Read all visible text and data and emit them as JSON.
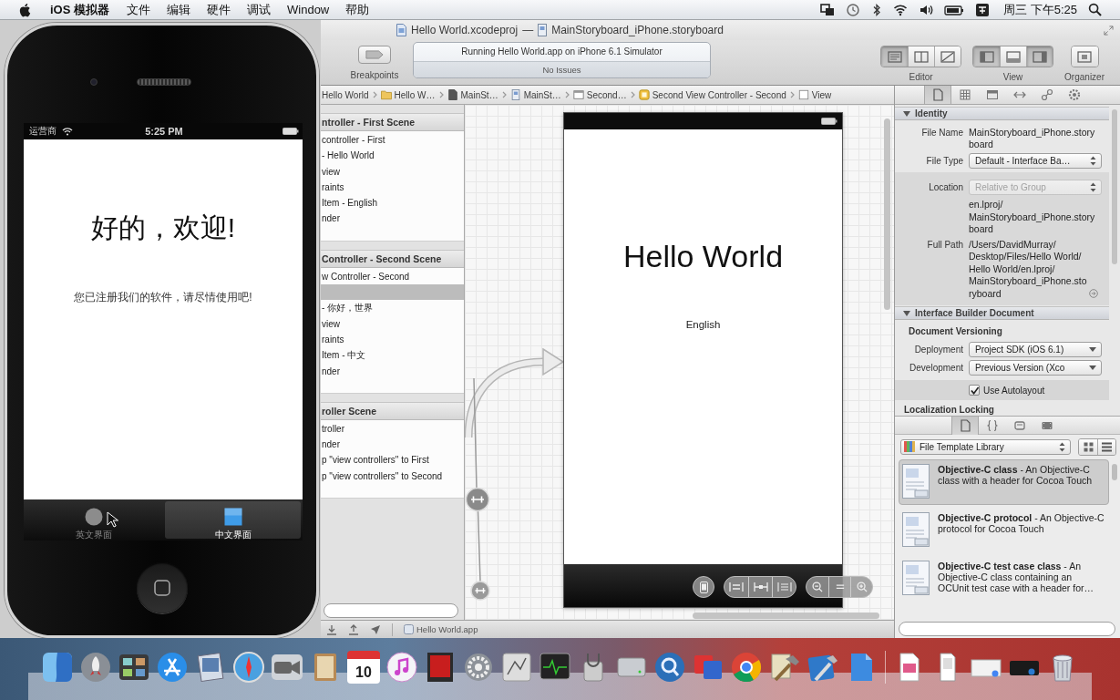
{
  "menu_bar": {
    "app_name": "iOS 模拟器",
    "menus": [
      "文件",
      "编辑",
      "硬件",
      "调试",
      "Window",
      "帮助"
    ],
    "clock": "周三 下午5:25"
  },
  "xcode": {
    "title": {
      "project": "Hello World.xcodeproj",
      "separator": "—",
      "file": "MainStoryboard_iPhone.storyboard"
    },
    "toolbar": {
      "breakpoints": "Breakpoints",
      "activity": {
        "status": "Running Hello World.app on iPhone 6.1 Simulator",
        "issues": "No Issues"
      },
      "groups": [
        {
          "label": "Editor",
          "buttons": [
            {
              "selected": true
            },
            {
              "selected": false
            },
            {
              "selected": false
            }
          ]
        },
        {
          "label": "View",
          "buttons": [
            {
              "selected": true
            },
            {
              "selected": false
            },
            {
              "selected": true
            }
          ]
        },
        {
          "label": "Organizer",
          "buttons": [
            {
              "selected": false
            }
          ]
        }
      ]
    },
    "jump_bar": [
      "Hello World",
      "Hello W…",
      "MainSt…",
      "MainSt…",
      "Second…",
      "Second View Controller - Second",
      "View"
    ],
    "outline": {
      "sections": [
        {
          "header": "ntroller - First Scene",
          "rows": [
            {
              "label": "controller - First",
              "selected": false
            },
            {
              "label": "- Hello World",
              "selected": false
            },
            {
              "label": "view",
              "selected": false
            },
            {
              "label": "raints",
              "selected": false
            },
            {
              "label": "Item - English",
              "selected": false
            },
            {
              "label": "nder",
              "selected": false
            }
          ]
        },
        {
          "header": "Controller - Second Scene",
          "rows": [
            {
              "label": "w Controller - Second",
              "selected": false
            },
            {
              "selected": true
            },
            {
              "label": "- 你好，世界",
              "selected": false
            },
            {
              "label": "view",
              "selected": false
            },
            {
              "label": "raints",
              "selected": false
            },
            {
              "label": "Item - 中文",
              "selected": false
            },
            {
              "label": "nder",
              "selected": false
            }
          ]
        },
        {
          "header": "roller Scene",
          "rows": [
            {
              "label": "troller",
              "selected": false
            },
            {
              "label": "nder",
              "selected": false
            },
            {
              "label": "p \"view controllers\" to First",
              "selected": false
            },
            {
              "label": "p \"view controllers\" to Second",
              "selected": false
            }
          ]
        }
      ]
    },
    "canvas": {
      "scene": {
        "heading": "Hello World",
        "label": "English"
      }
    },
    "debug_bar": {
      "target": "Hello World.app"
    },
    "inspector": {
      "tabs": [
        {
          "selected": true
        },
        {
          "selected": false
        },
        {
          "selected": false
        },
        {
          "selected": false
        },
        {
          "selected": false
        },
        {
          "selected": false
        }
      ],
      "identity": {
        "title": "Identity",
        "expanded": true,
        "file_name": {
          "label": "File Name",
          "value": "MainStoryboard_iPhone.storyboard"
        },
        "file_type": {
          "label": "File Type",
          "value": "Default - Interface Ba…"
        },
        "location": {
          "label": "Location",
          "value": "Relative to Group",
          "disabled": true,
          "path": "en.lproj/MainStoryboard_iPhone.storyboard"
        },
        "full_path": {
          "label": "Full Path",
          "value": "/Users/DavidMurray/Desktop/Files/Hello World/Hello World/en.lproj/MainStoryboard_iPhone.storyboard"
        }
      },
      "ib_document": {
        "title": "Interface Builder Document",
        "expanded": true,
        "versioning": "Document Versioning",
        "deployment": {
          "label": "Deployment",
          "value": "Project SDK (iOS 6.1)"
        },
        "development": {
          "label": "Development",
          "value": "Previous Version (Xco"
        },
        "autolayout": {
          "label": "Use Autolayout",
          "checked": true
        },
        "localization": "Localization Locking"
      }
    },
    "library": {
      "tabs": [
        {
          "selected": true
        },
        {
          "selected": false
        },
        {
          "selected": false
        },
        {
          "selected": false
        }
      ],
      "picker": "File Template Library",
      "items": [
        {
          "text": "**Objective-C class** - An Objective-C class with a header for Cocoa Touch",
          "selected": true
        },
        {
          "text": "**Objective-C protocol** - An Objective-C protocol for Cocoa Touch",
          "selected": false
        },
        {
          "text": "**Objective-C test case class** - An Objective-C class containing an OCUnit test case with a header for…",
          "selected": false
        }
      ]
    }
  },
  "simulator": {
    "status_bar": {
      "carrier": "运营商",
      "time": "5:25 PM"
    },
    "heading": "好的，欢迎!",
    "message": "您已注册我们的软件，请尽情使用吧!",
    "tabs": [
      {
        "label": "英文界面",
        "selected": false
      },
      {
        "label": "中文界面",
        "selected": true
      }
    ]
  },
  "dock": {
    "calendar_day": "10"
  }
}
